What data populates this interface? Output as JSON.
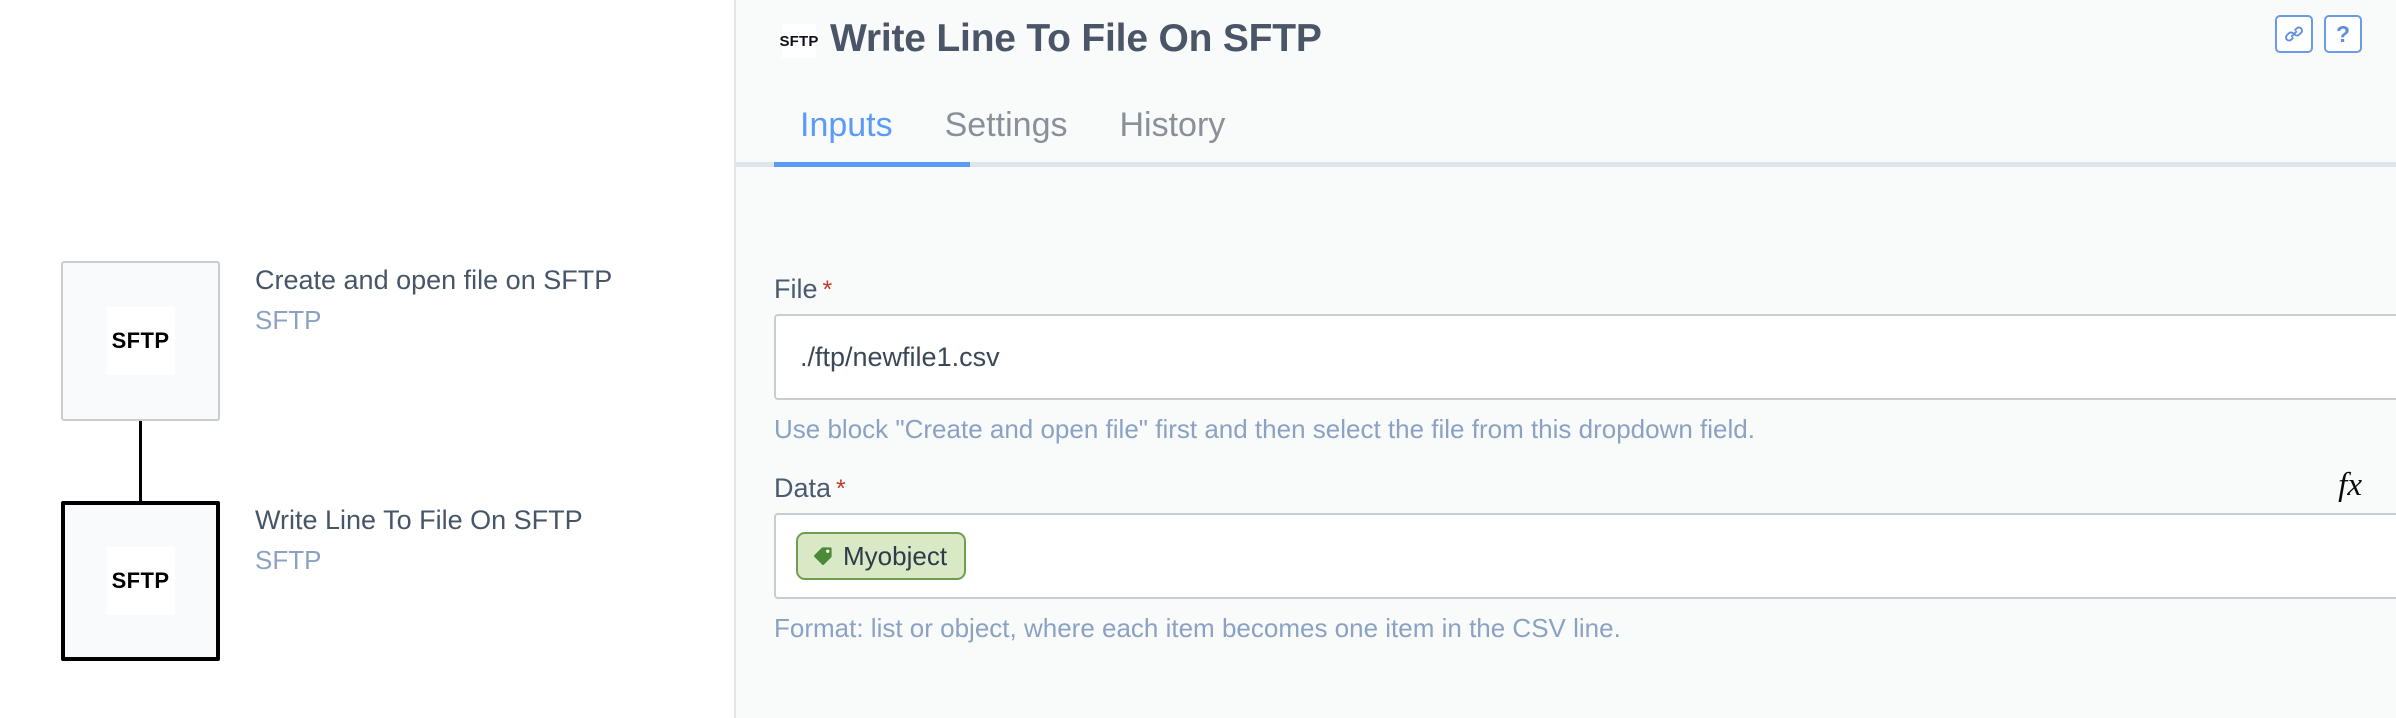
{
  "canvas": {
    "nodes": [
      {
        "badge": "SFTP",
        "title": "Create and open file on SFTP",
        "subtitle": "SFTP",
        "selected": false
      },
      {
        "badge": "SFTP",
        "title": "Write Line To File On SFTP",
        "subtitle": "SFTP",
        "selected": true
      }
    ]
  },
  "header": {
    "badge": "SFTP",
    "title": "Write Line To File On SFTP",
    "link_icon": "link-icon",
    "help_label": "?"
  },
  "tabs": [
    {
      "label": "Inputs",
      "active": true
    },
    {
      "label": "Settings",
      "active": false
    },
    {
      "label": "History",
      "active": false
    }
  ],
  "form": {
    "file": {
      "label": "File",
      "required_marker": "*",
      "value": "./ftp/newfile1.csv",
      "placeholder": "",
      "helper": "Use block \"Create and open file\" first and then select the file from this dropdown field.",
      "dropdown_icon": "chevron-down-icon"
    },
    "data": {
      "label": "Data",
      "required_marker": "*",
      "chip_label": "Myobject",
      "chip_icon": "tag-icon",
      "helper": "Format: list or object, where each item becomes one item in the CSV line.",
      "dropdown_icon": "chevron-down-icon",
      "fx_label": "fx"
    }
  },
  "colors": {
    "accent_blue": "#5b9bf8",
    "tab_inactive": "#8a9099",
    "helper_text": "#8ba2c4",
    "required_red": "#c0392b",
    "chip_bg": "#d9e9c6",
    "chip_border": "#6f9e52",
    "panel_bg": "#f9fafa"
  }
}
